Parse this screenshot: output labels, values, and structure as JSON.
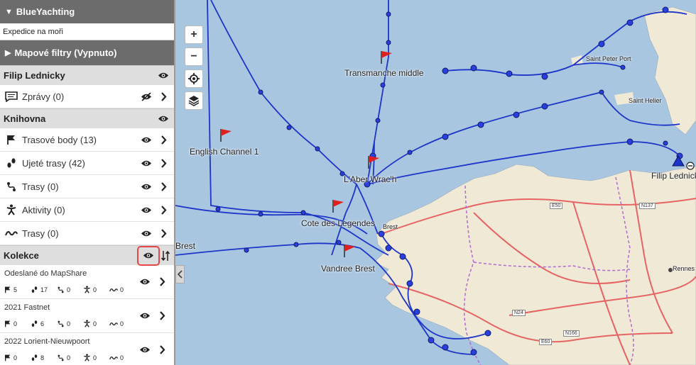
{
  "app": {
    "title": "BlueYachting",
    "subtitle": "Expedice na moři",
    "filters_label": "Mapové filtry (Vypnuto)"
  },
  "user": {
    "name": "Filip Lednicky",
    "messages_label": "Zprávy (0)"
  },
  "library": {
    "title": "Knihovna",
    "items": [
      {
        "label": "Trasové body (13)",
        "icon": "flag-icon"
      },
      {
        "label": "Ujeté trasy (42)",
        "icon": "footsteps-icon"
      },
      {
        "label": "Trasy (0)",
        "icon": "route-icon"
      },
      {
        "label": "Aktivity (0)",
        "icon": "activity-icon"
      },
      {
        "label": "Trasy (0)",
        "icon": "track-icon"
      }
    ]
  },
  "collections": {
    "title": "Kolekce",
    "items": [
      {
        "name": "Odeslané do MapShare",
        "counts": [
          "5",
          "17",
          "0",
          "0",
          "0"
        ]
      },
      {
        "name": "2021 Fastnet",
        "counts": [
          "0",
          "6",
          "0",
          "0",
          "0"
        ]
      },
      {
        "name": "2022 Lorient-Nieuwpoort",
        "counts": [
          "0",
          "8",
          "0",
          "0",
          "0"
        ]
      }
    ]
  },
  "map": {
    "labels": {
      "transmanche": "Transmanche middle",
      "english_channel": "English Channel 1",
      "aber_wrach": "L'Aber Wrac'h",
      "cote_legendes": "Cote des Legendes",
      "vandree": "Vandree Brest",
      "brest_sidebar": "Brest",
      "brest": "Brest",
      "saint_peter": "Saint Peter Port",
      "saint_helier": "Saint Helier",
      "filip": "Filip Lednick",
      "rennes": "Rennes"
    },
    "roads": {
      "e50": "E50",
      "n137": "N137",
      "n24": "N24",
      "n166": "N166",
      "e60": "E60"
    },
    "controls": {
      "zoom_in": "+",
      "zoom_out": "−"
    }
  },
  "colors": {
    "track": "#1d34c9",
    "sea": "#a9c6e0",
    "land": "#efe9d6",
    "flag": "#e01f1f",
    "highlight": "#e54848"
  }
}
